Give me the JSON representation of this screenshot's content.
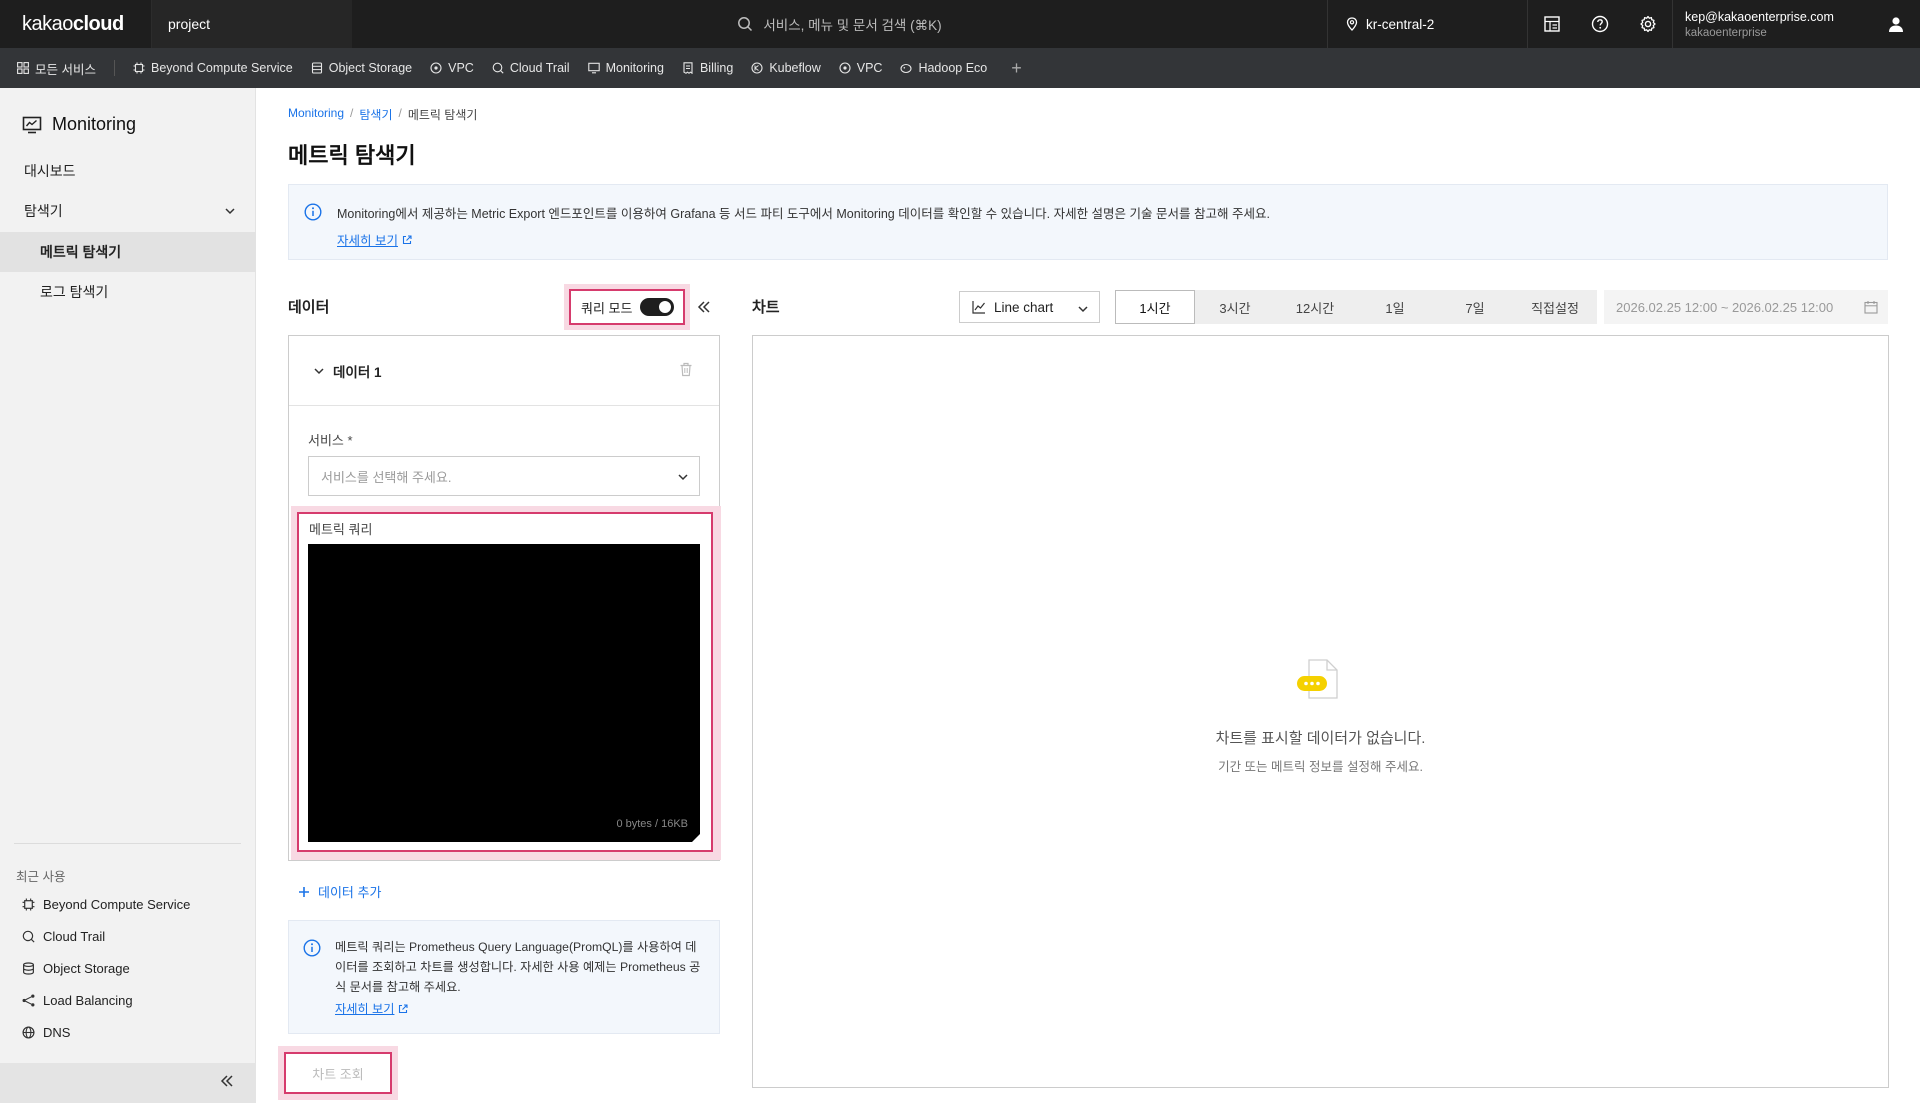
{
  "topbar": {
    "logo_light": "kakao",
    "logo_bold": "cloud",
    "project": "project",
    "search_placeholder": "서비스, 메뉴 및 문서 검색 (⌘K)",
    "region": "kr-central-2",
    "user_email": "kep@kakaoenterprise.com",
    "user_org": "kakaoenterprise"
  },
  "servicebar": {
    "all_services": "모든 서비스",
    "items": [
      "Beyond Compute Service",
      "Object Storage",
      "VPC",
      "Cloud Trail",
      "Monitoring",
      "Billing",
      "Kubeflow",
      "VPC",
      "Hadoop Eco"
    ],
    "add": "+"
  },
  "sidebar": {
    "title": "Monitoring",
    "dashboard": "대시보드",
    "explorer": "탐색기",
    "metric_explorer": "메트릭 탐색기",
    "log_explorer": "로그 탐색기",
    "recent_label": "최근 사용",
    "recent": [
      "Beyond Compute Service",
      "Cloud Trail",
      "Object Storage",
      "Load Balancing",
      "DNS"
    ]
  },
  "breadcrumb": {
    "root": "Monitoring",
    "sep": "/",
    "parent": "탐색기",
    "current": "메트릭 탐색기"
  },
  "page": {
    "title": "메트릭 탐색기",
    "info_text": "Monitoring에서 제공하는 Metric Export 엔드포인트를 이용하여 Grafana 등 서드 파티 도구에서 Monitoring 데이터를 확인할 수 있습니다. 자세한 설명은 기술 문서를 참고해 주세요.",
    "info_more": "자세히 보기"
  },
  "data_panel": {
    "title": "데이터",
    "query_mode_label": "쿼리 모드",
    "query_mode_on": true,
    "card_title": "데이터 1",
    "service_label": "서비스 *",
    "service_placeholder": "서비스를 선택해 주세요.",
    "metric_query_label": "메트릭 쿼리",
    "byte_counter": "0 bytes / 16KB",
    "add_data": "데이터 추가",
    "query_info_text": "메트릭 쿼리는 Prometheus Query Language(PromQL)를 사용하여 데이터를 조회하고 차트를 생성합니다.  자세한 사용 예제는 Prometheus 공식 문서를 참고해 주세요.",
    "query_info_more": "자세히 보기",
    "view_chart_button": "차트 조회"
  },
  "chart_panel": {
    "title": "차트",
    "chart_type": "Line chart",
    "ranges": [
      "1시간",
      "3시간",
      "12시간",
      "1일",
      "7일",
      "직접설정"
    ],
    "selected_range": "1시간",
    "date_range": "2026.02.25 12:00 ~ 2026.02.25 12:00",
    "empty_title": "차트를 표시할 데이터가 없습니다.",
    "empty_subtitle": "기간 또는 메트릭 정보를 설정해 주세요."
  },
  "colors": {
    "topbar_bg": "#1e1e1e",
    "servicebar_bg": "#333538",
    "accent_link": "#1a73e8",
    "highlight_border": "#d63b6d",
    "highlight_fill": "#f8d9e3",
    "empty_icon_yellow": "#f5d100"
  }
}
